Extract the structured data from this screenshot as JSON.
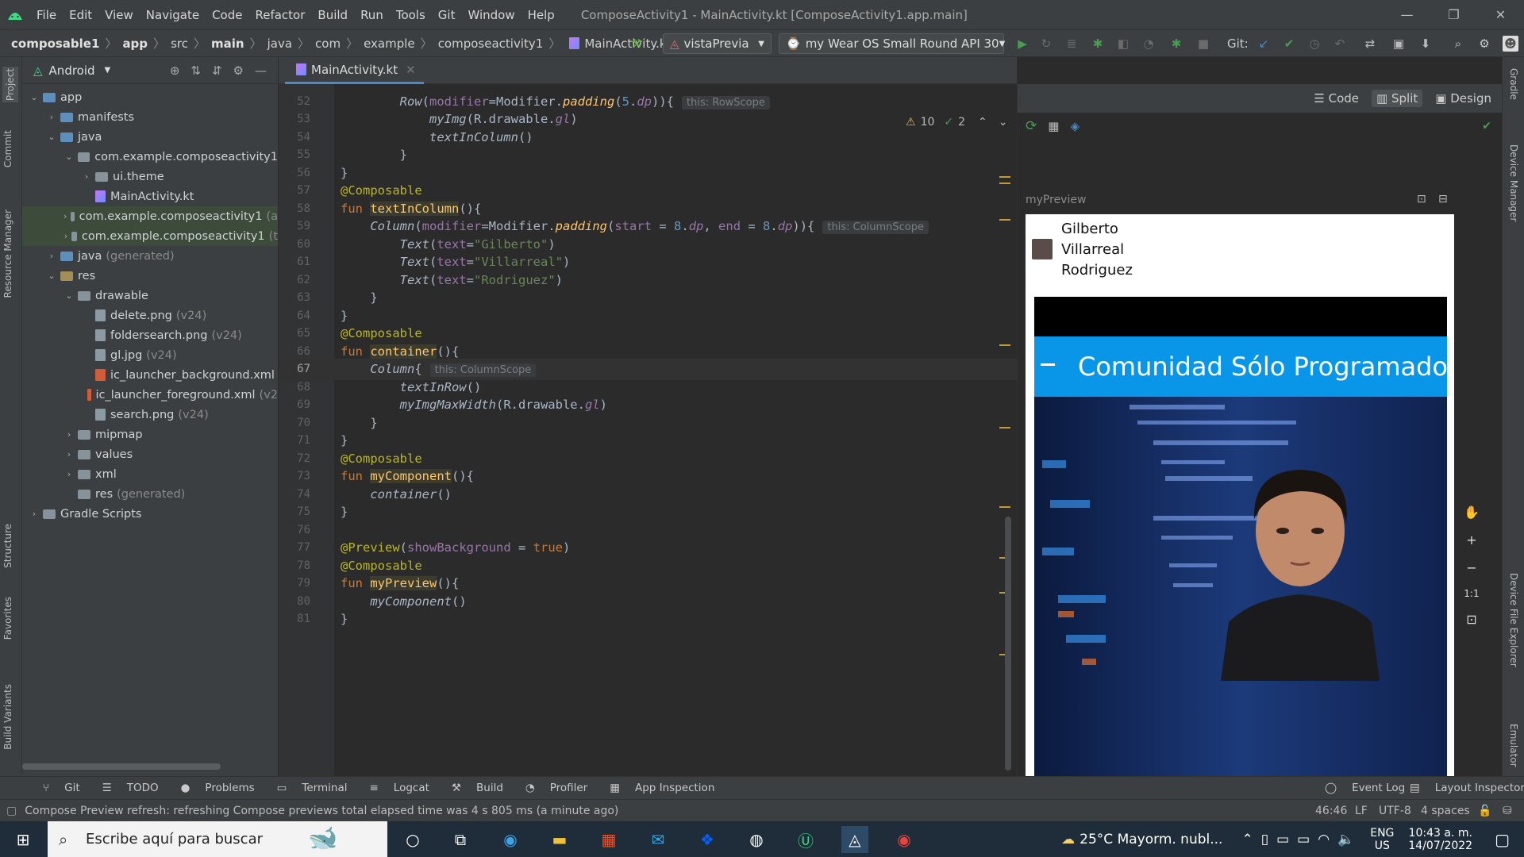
{
  "menu": {
    "items": [
      "File",
      "Edit",
      "View",
      "Navigate",
      "Code",
      "Refactor",
      "Build",
      "Run",
      "Tools",
      "Git",
      "Window",
      "Help"
    ],
    "window_title": "ComposeActivity1 - MainActivity.kt [ComposeActivity1.app.main]"
  },
  "breadcrumb": {
    "items": [
      "composable1",
      "app",
      "src",
      "main",
      "java",
      "com",
      "example",
      "composeactivity1",
      "MainActivity.kt"
    ]
  },
  "toolbar": {
    "run_config": "vistaPrevia",
    "device": "my Wear OS Small Round API 30",
    "git_label": "Git:"
  },
  "project": {
    "view": "Android",
    "tree": [
      {
        "label": "app",
        "depth": 0,
        "open": true,
        "kind": "folder-blue"
      },
      {
        "label": "manifests",
        "depth": 1,
        "open": false,
        "kind": "folder-blue"
      },
      {
        "label": "java",
        "depth": 1,
        "open": true,
        "kind": "folder-blue"
      },
      {
        "label": "com.example.composeactivity1",
        "depth": 2,
        "open": true,
        "kind": "folder"
      },
      {
        "label": "ui.theme",
        "depth": 3,
        "open": false,
        "kind": "folder"
      },
      {
        "label": "MainActivity.kt",
        "depth": 3,
        "kind": "file-kt"
      },
      {
        "label": "com.example.composeactivity1",
        "suffix": "(a",
        "depth": 2,
        "open": false,
        "kind": "folder",
        "selected": true
      },
      {
        "label": "com.example.composeactivity1",
        "suffix": "(t",
        "depth": 2,
        "open": false,
        "kind": "folder",
        "selected": true
      },
      {
        "label": "java",
        "suffix": "(generated)",
        "depth": 1,
        "open": false,
        "kind": "folder-blue"
      },
      {
        "label": "res",
        "depth": 1,
        "open": true,
        "kind": "folder-res"
      },
      {
        "label": "drawable",
        "depth": 2,
        "open": true,
        "kind": "folder"
      },
      {
        "label": "delete.png",
        "suffix": "(v24)",
        "depth": 3,
        "kind": "file"
      },
      {
        "label": "foldersearch.png",
        "suffix": "(v24)",
        "depth": 3,
        "kind": "file"
      },
      {
        "label": "gl.jpg",
        "suffix": "(v24)",
        "depth": 3,
        "kind": "file"
      },
      {
        "label": "ic_launcher_background.xml",
        "depth": 3,
        "kind": "file-xml"
      },
      {
        "label": "ic_launcher_foreground.xml",
        "suffix": "(v2",
        "depth": 3,
        "kind": "file-xml"
      },
      {
        "label": "search.png",
        "suffix": "(v24)",
        "depth": 3,
        "kind": "file"
      },
      {
        "label": "mipmap",
        "depth": 2,
        "open": false,
        "kind": "folder"
      },
      {
        "label": "values",
        "depth": 2,
        "open": false,
        "kind": "folder"
      },
      {
        "label": "xml",
        "depth": 2,
        "open": false,
        "kind": "folder"
      },
      {
        "label": "res",
        "suffix": "(generated)",
        "depth": 2,
        "kind": "folder"
      },
      {
        "label": "Gradle Scripts",
        "depth": 0,
        "open": false,
        "kind": "gradle"
      }
    ]
  },
  "left_tabs": [
    "Project",
    "Commit",
    "Resource Manager",
    "Structure",
    "Favorites",
    "Build Variants"
  ],
  "right_tabs": [
    "Gradle",
    "Device Manager",
    "Device File Explorer",
    "Emulator"
  ],
  "editor": {
    "tab": "MainActivity.kt",
    "warnings": "10",
    "ok": "2",
    "current_line": "67",
    "lines": [
      {
        "n": "52",
        "html": "        <span class='it'>Row</span>(<span class='par'>modifier</span>=Modifier.<span class='it fn'>padding</span>(<span class='num'>5</span>.<span class='it par'>dp</span>)){<span class='hint'>this: RowScope</span>"
      },
      {
        "n": "53",
        "html": "            <span class='it'>myImg</span>(R.drawable.<span class='it par'>gl</span>)"
      },
      {
        "n": "54",
        "html": "            <span class='it'>textInColumn</span>()"
      },
      {
        "n": "55",
        "html": "        }"
      },
      {
        "n": "56",
        "html": "}"
      },
      {
        "n": "57",
        "html": "<span class='ann'>@Composable</span>"
      },
      {
        "n": "58",
        "html": "<span class='kw'>fun</span> <span class='fnh'>textInColumn</span>(){"
      },
      {
        "n": "59",
        "html": "    <span class='it'>Column</span>(<span class='par'>modifier</span>=Modifier.<span class='it fn'>padding</span>(<span class='par'>start</span> = <span class='num'>8</span>.<span class='it par'>dp</span>, <span class='par'>end</span> = <span class='num'>8</span>.<span class='it par'>dp</span>)){<span class='hint'>this: ColumnScope</span>"
      },
      {
        "n": "60",
        "html": "        <span class='it'>Text</span>(<span class='par'>text</span>=<span class='str'>\"Gilberto\"</span>)"
      },
      {
        "n": "61",
        "html": "        <span class='it'>Text</span>(<span class='par'>text</span>=<span class='str'>\"Villarreal\"</span>)"
      },
      {
        "n": "62",
        "html": "        <span class='it'>Text</span>(<span class='par'>text</span>=<span class='str'>\"Rodriguez\"</span>)"
      },
      {
        "n": "63",
        "html": "    }"
      },
      {
        "n": "64",
        "html": "}"
      },
      {
        "n": "65",
        "html": "<span class='ann'>@Composable</span>"
      },
      {
        "n": "66",
        "html": "<span class='kw'>fun</span> <span class='fnh'>container</span>(){"
      },
      {
        "n": "67",
        "html": "    <span class='it'>Column</span>{<span class='hint'>this: ColumnScope</span>"
      },
      {
        "n": "68",
        "html": "        <span class='it'>textInRow</span>()"
      },
      {
        "n": "69",
        "html": "        <span class='it'>myImgMaxWidth</span>(R.drawable.<span class='it par'>gl</span>)"
      },
      {
        "n": "70",
        "html": "    }"
      },
      {
        "n": "71",
        "html": "}"
      },
      {
        "n": "72",
        "html": "<span class='ann'>@Composable</span>"
      },
      {
        "n": "73",
        "html": "<span class='kw'>fun</span> <span class='fnh'>myComponent</span>(){"
      },
      {
        "n": "74",
        "html": "    <span class='it'>container</span>()"
      },
      {
        "n": "75",
        "html": "}"
      },
      {
        "n": "76",
        "html": ""
      },
      {
        "n": "77",
        "html": "<span class='ann'>@Preview</span>(<span class='par'>showBackground</span> = <span class='kw'>true</span>)"
      },
      {
        "n": "78",
        "html": "<span class='ann'>@Composable</span>"
      },
      {
        "n": "79",
        "html": "<span class='kw'>fun</span> <span class='fnh'>myPreview</span>(){"
      },
      {
        "n": "80",
        "html": "    <span class='it'>myComponent</span>()"
      },
      {
        "n": "81",
        "html": "}"
      }
    ]
  },
  "preview": {
    "modes": [
      "Code",
      "Split",
      "Design"
    ],
    "name": "myPreview",
    "names": [
      "Gilberto",
      "Villarreal",
      "Rodriguez"
    ],
    "banner": "Comunidad Sólo Programado",
    "zoom": [
      "+",
      "−",
      "1:1"
    ]
  },
  "toolwindows": [
    "Git",
    "TODO",
    "Problems",
    "Terminal",
    "Logcat",
    "Build",
    "Profiler",
    "App Inspection"
  ],
  "toolwindows_right": [
    "Event Log",
    "Layout Inspector"
  ],
  "status": {
    "message": "Compose Preview refresh: refreshing Compose previews total elapsed time was 4 s 805 ms (a minute ago)",
    "position": "46:46",
    "line_sep": "LF",
    "encoding": "UTF-8",
    "indent": "4 spaces"
  },
  "taskbar": {
    "search_placeholder": "Escribe aquí para buscar",
    "weather": "25°C  Mayorm. nubl...",
    "lang": "ENG",
    "region": "US",
    "time": "10:43 a. m.",
    "date": "14/07/2022"
  },
  "colors": {
    "accent": "#4a88c7",
    "android_green": "#3ddc84",
    "run_green": "#499c54"
  }
}
